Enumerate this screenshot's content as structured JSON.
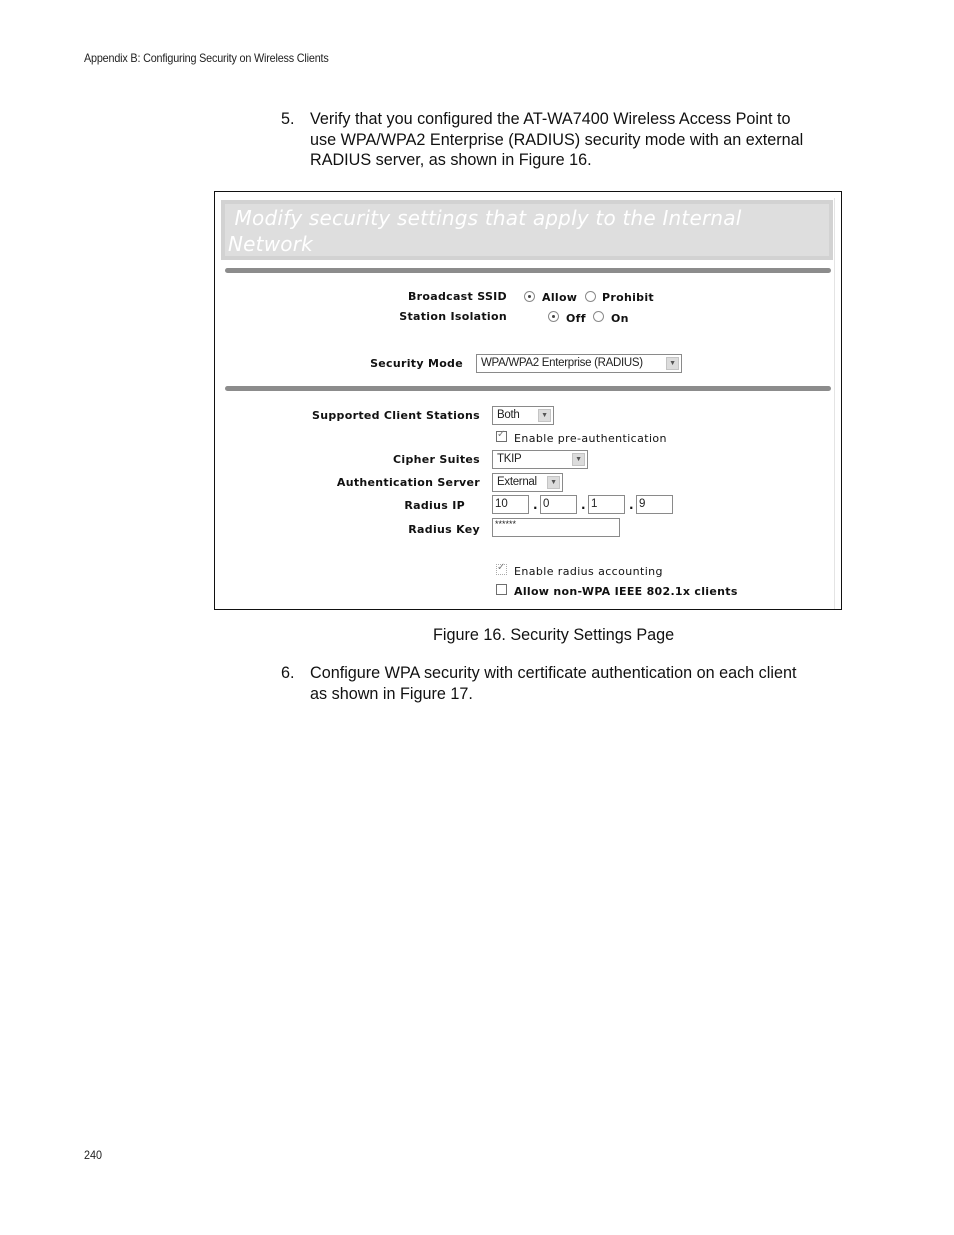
{
  "running_header": "Appendix B: Configuring Security on Wireless Clients",
  "page_number": "240",
  "steps": [
    {
      "number": "5.",
      "lines": [
        "Verify that you configured the AT-WA7400 Wireless Access Point to",
        "use WPA/WPA2 Enterprise (RADIUS) security mode with an external",
        "RADIUS server, as shown in Figure 16."
      ]
    },
    {
      "number": "6.",
      "lines": [
        "Configure WPA security with certificate authentication on each client",
        "as shown in Figure 17."
      ]
    }
  ],
  "figure": {
    "caption": "Figure 16. Security Settings Page",
    "banner_title_line1": " Modify security settings that apply to the Internal",
    "banner_title_line2": "Network",
    "broadcast_ssid": {
      "label": "Broadcast SSID",
      "options": [
        "Allow",
        "Prohibit"
      ],
      "selected": "Allow"
    },
    "station_isolation": {
      "label": "Station Isolation",
      "options": [
        "Off",
        "On"
      ],
      "selected": "Off"
    },
    "security_mode": {
      "label": "Security Mode",
      "value": "WPA/WPA2 Enterprise (RADIUS)"
    },
    "supported_client_stations": {
      "label": "Supported Client Stations",
      "value": "Both"
    },
    "pre_authentication": {
      "label": "Enable pre-authentication",
      "checked": true
    },
    "cipher_suites": {
      "label": "Cipher Suites",
      "value": "TKIP"
    },
    "authentication_server": {
      "label": "Authentication Server",
      "value": "External"
    },
    "radius_ip": {
      "label": "Radius IP",
      "octets": [
        "10",
        "0",
        "1",
        "9"
      ],
      "separator": "."
    },
    "radius_key": {
      "label": "Radius Key",
      "value": "******"
    },
    "radius_accounting": {
      "label": "Enable radius accounting",
      "checked": true,
      "disabled": true
    },
    "non_wpa_clients": {
      "label": "Allow non-WPA IEEE 802.1x clients",
      "checked": false
    }
  }
}
